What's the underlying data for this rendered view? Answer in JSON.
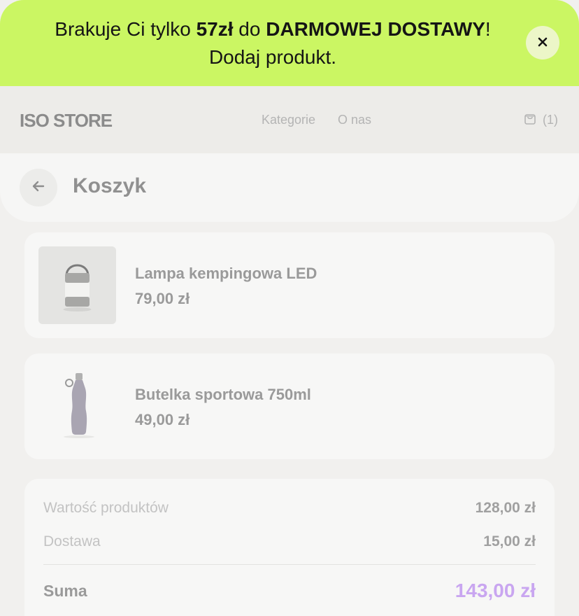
{
  "promo": {
    "text_1": "Brakuje Ci tylko ",
    "amount": "57zł",
    "text_2": " do ",
    "highlight": "DARMOWEJ DOSTAWY",
    "text_3": "! Dodaj produkt.",
    "close_icon": "close-icon"
  },
  "header": {
    "logo": "ISO STORE",
    "nav": [
      "Kategorie",
      "O nas"
    ],
    "cart_count": "(1)",
    "cart_icon": "shopping-bag-icon"
  },
  "page": {
    "title": "Koszyk",
    "back_icon": "arrow-left-icon"
  },
  "cart": {
    "items": [
      {
        "name": "Lampa kempingowa LED",
        "price": "79,00 zł",
        "image": "camping-lamp-image"
      },
      {
        "name": "Butelka sportowa 750ml",
        "price": "49,00 zł",
        "image": "sport-bottle-image"
      }
    ]
  },
  "summary": {
    "products_label": "Wartość produktów",
    "products_value": "128,00 zł",
    "shipping_label": "Dostawa",
    "shipping_value": "15,00 zł",
    "total_label": "Suma",
    "total_value": "143,00 zł"
  },
  "colors": {
    "promo_bg": "#cbf663",
    "total_accent": "#c9a6f0"
  }
}
